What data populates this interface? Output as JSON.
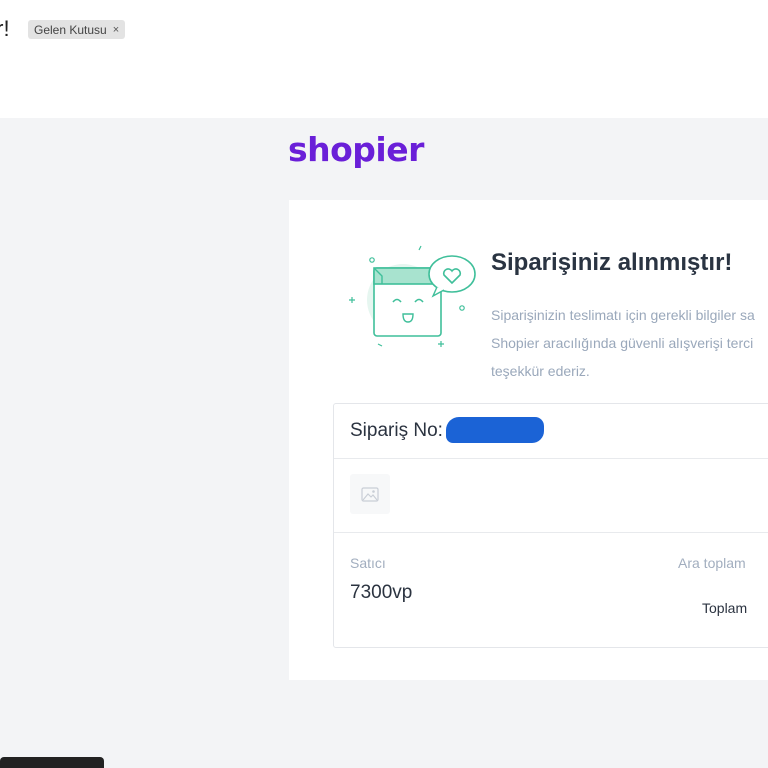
{
  "email": {
    "subject_fragment": "ır!",
    "label_chip": {
      "text": "Gelen Kutusu",
      "close": "×"
    }
  },
  "brand": {
    "logo_text": "shopier",
    "color": "#6a1fd8"
  },
  "confirmation": {
    "title": "Siparişiniz alınmıştır!",
    "lines": [
      "Siparişinizin teslimatı için gerekli bilgiler sa",
      "Shopier aracılığında güvenli alışverişi terci",
      "teşekkür ederiz."
    ],
    "illustration_icon": "smiling-box-with-heart-bubble-icon"
  },
  "order": {
    "number_label": "Sipariş No:",
    "product_image_icon": "image-placeholder-icon",
    "seller_label": "Satıcı",
    "seller_value": "7300vp",
    "subtotal_label": "Ara toplam",
    "total_label": "Toplam"
  },
  "colors": {
    "background": "#f3f4f6",
    "accent_teal": "#3fbf9a",
    "muted_text": "#9aa8bb",
    "heading_text": "#2a3442",
    "redaction": "#1b63d6"
  }
}
